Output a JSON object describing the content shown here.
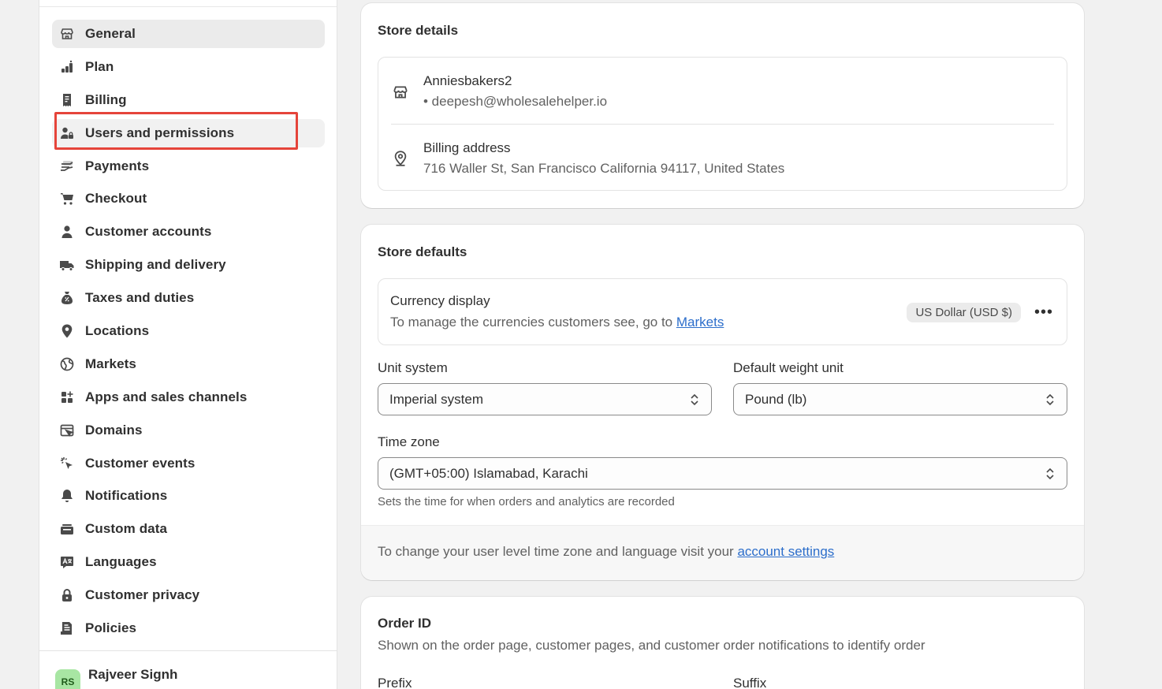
{
  "sidebar": {
    "items": [
      {
        "label": "General",
        "icon": "store-icon"
      },
      {
        "label": "Plan",
        "icon": "plan-icon"
      },
      {
        "label": "Billing",
        "icon": "billing-icon"
      },
      {
        "label": "Users and permissions",
        "icon": "users-icon"
      },
      {
        "label": "Payments",
        "icon": "payments-icon"
      },
      {
        "label": "Checkout",
        "icon": "cart-icon"
      },
      {
        "label": "Customer accounts",
        "icon": "person-icon"
      },
      {
        "label": "Shipping and delivery",
        "icon": "truck-icon"
      },
      {
        "label": "Taxes and duties",
        "icon": "tax-bag-icon"
      },
      {
        "label": "Locations",
        "icon": "location-pin-icon"
      },
      {
        "label": "Markets",
        "icon": "globe-icon"
      },
      {
        "label": "Apps and sales channels",
        "icon": "apps-icon"
      },
      {
        "label": "Domains",
        "icon": "domains-icon"
      },
      {
        "label": "Customer events",
        "icon": "cursor-click-icon"
      },
      {
        "label": "Notifications",
        "icon": "bell-icon"
      },
      {
        "label": "Custom data",
        "icon": "custom-data-icon"
      },
      {
        "label": "Languages",
        "icon": "translate-icon"
      },
      {
        "label": "Customer privacy",
        "icon": "lock-icon"
      },
      {
        "label": "Policies",
        "icon": "policies-icon"
      }
    ],
    "active_index": 0,
    "highlighted_index": 3,
    "user": {
      "initials": "RS",
      "name": "Rajveer Signh"
    }
  },
  "store_details": {
    "title": "Store details",
    "store_name": "Anniesbakers2",
    "store_email": "• deepesh@wholesalehelper.io",
    "billing_label": "Billing address",
    "billing_address": "716 Waller St, San Francisco California 94117, United States"
  },
  "store_defaults": {
    "title": "Store defaults",
    "currency_title": "Currency display",
    "currency_sub": "To manage the currencies customers see, go to ",
    "currency_link": "Markets",
    "currency_badge": "US Dollar (USD $)",
    "more_label": "•••",
    "unit_system_label": "Unit system",
    "unit_system_value": "Imperial system",
    "weight_unit_label": "Default weight unit",
    "weight_unit_value": "Pound (lb)",
    "time_zone_label": "Time zone",
    "time_zone_value": "(GMT+05:00) Islamabad, Karachi",
    "time_zone_help": "Sets the time for when orders and analytics are recorded",
    "footer_text": "To change your user level time zone and language visit your ",
    "footer_link": "account settings"
  },
  "order_id": {
    "title": "Order ID",
    "description": "Shown on the order page, customer pages, and customer order notifications to identify order",
    "prefix_label": "Prefix",
    "suffix_label": "Suffix"
  },
  "colors": {
    "highlight": "#e5443a",
    "link": "#2c6ecb",
    "avatar_bg": "#a8e6a3"
  }
}
